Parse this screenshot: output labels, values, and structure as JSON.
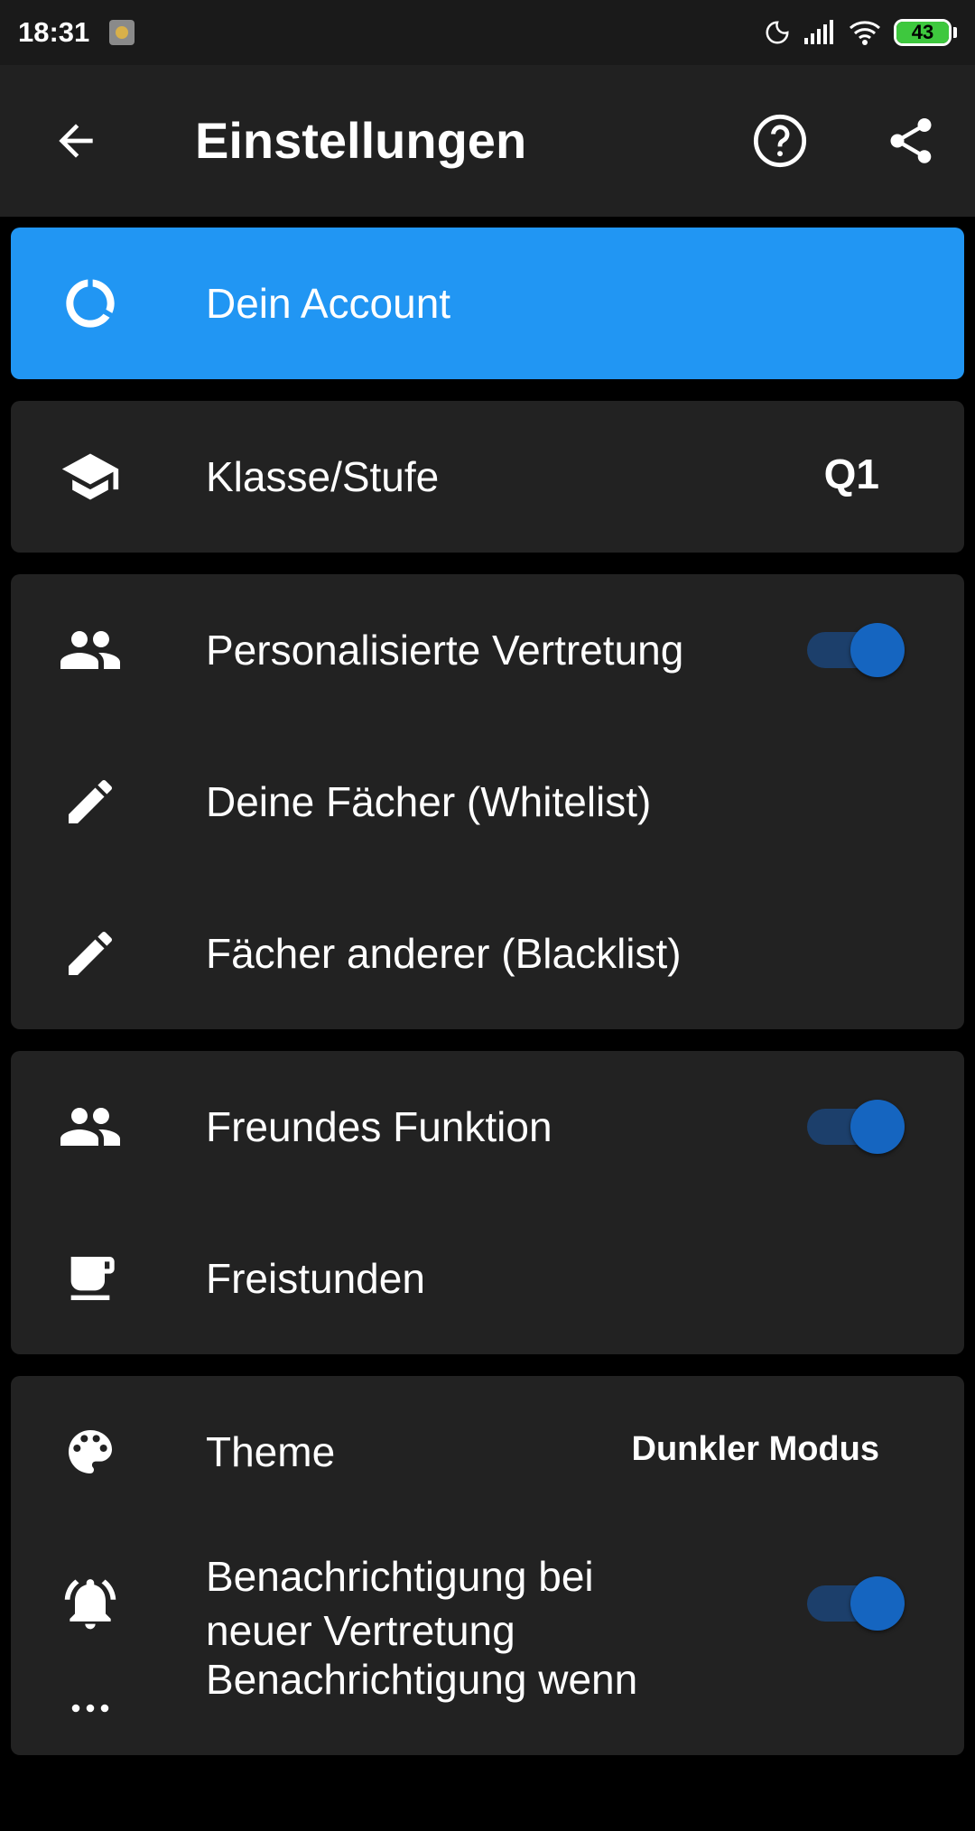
{
  "status_bar": {
    "time": "18:31",
    "battery": "43",
    "icons": [
      "moon-icon",
      "signal-icon",
      "wifi-icon",
      "battery-icon"
    ]
  },
  "app_bar": {
    "title": "Einstellungen",
    "icons": [
      "back-arrow-icon",
      "help-icon",
      "share-icon"
    ]
  },
  "account": {
    "label": "Dein Account",
    "icon": "account-ring-icon",
    "accent_color": "#2196f3"
  },
  "class_card": {
    "label": "Klasse/Stufe",
    "value": "Q1",
    "icon": "graduation-cap-icon"
  },
  "substitution_card": {
    "personalized": {
      "label": "Personalisierte Vertretung",
      "enabled": true,
      "icon": "people-icon"
    },
    "whitelist": {
      "label": "Deine Fächer (Whitelist)",
      "icon": "pencil-icon"
    },
    "blacklist": {
      "label": "Fächer anderer (Blacklist)",
      "icon": "pencil-icon"
    }
  },
  "friends_card": {
    "friends": {
      "label": "Freundes Funktion",
      "enabled": true,
      "icon": "people-icon"
    },
    "free_periods": {
      "label": "Freistunden",
      "icon": "coffee-cup-icon"
    }
  },
  "misc_card": {
    "theme": {
      "label": "Theme",
      "value": "Dunkler Modus",
      "icon": "palette-icon"
    },
    "notify_new": {
      "label_line1": "Benachrichtigung bei",
      "label_line2": "neuer Vertretung",
      "enabled": true,
      "icon": "bell-icon"
    },
    "notify_when": {
      "label_line1": "Benachrichtigung wenn"
    }
  },
  "colors": {
    "switch_knob": "#1565c0",
    "switch_track": "#1c3f6b",
    "card_bg": "#222222"
  }
}
